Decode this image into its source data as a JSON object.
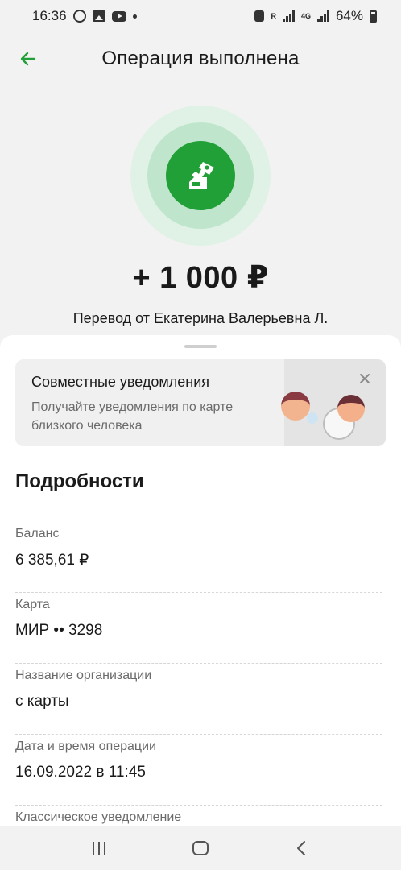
{
  "status_bar": {
    "time": "16:36",
    "network_r": "R",
    "network_4g": "4G",
    "battery": "64%"
  },
  "header": {
    "title": "Операция выполнена",
    "back_icon": "arrow-left-icon"
  },
  "colors": {
    "accent": "#21a038",
    "icon_ring_outer": "#dff2e5",
    "icon_ring_mid": "#bfe6cc"
  },
  "operation": {
    "icon": "transfer-icon",
    "amount": "+ 1 000 ₽",
    "description": "Перевод от Екатерина Валерьевна Л."
  },
  "promo": {
    "title": "Совместные уведомления",
    "text": "Получайте уведомления по карте близкого человека"
  },
  "details": {
    "title": "Подробности",
    "items": [
      {
        "label": "Баланс",
        "value": "6 385,61 ₽"
      },
      {
        "label": "Карта",
        "value": "МИР •• 3298"
      },
      {
        "label": "Название организации",
        "value": "с карты"
      },
      {
        "label": "Дата и время операции",
        "value": "16.09.2022 в 11:45"
      },
      {
        "label": "Классическое уведомление",
        "value": ""
      }
    ]
  },
  "nav": {
    "recents": "recents-icon",
    "home": "home-icon",
    "back": "back-icon"
  }
}
